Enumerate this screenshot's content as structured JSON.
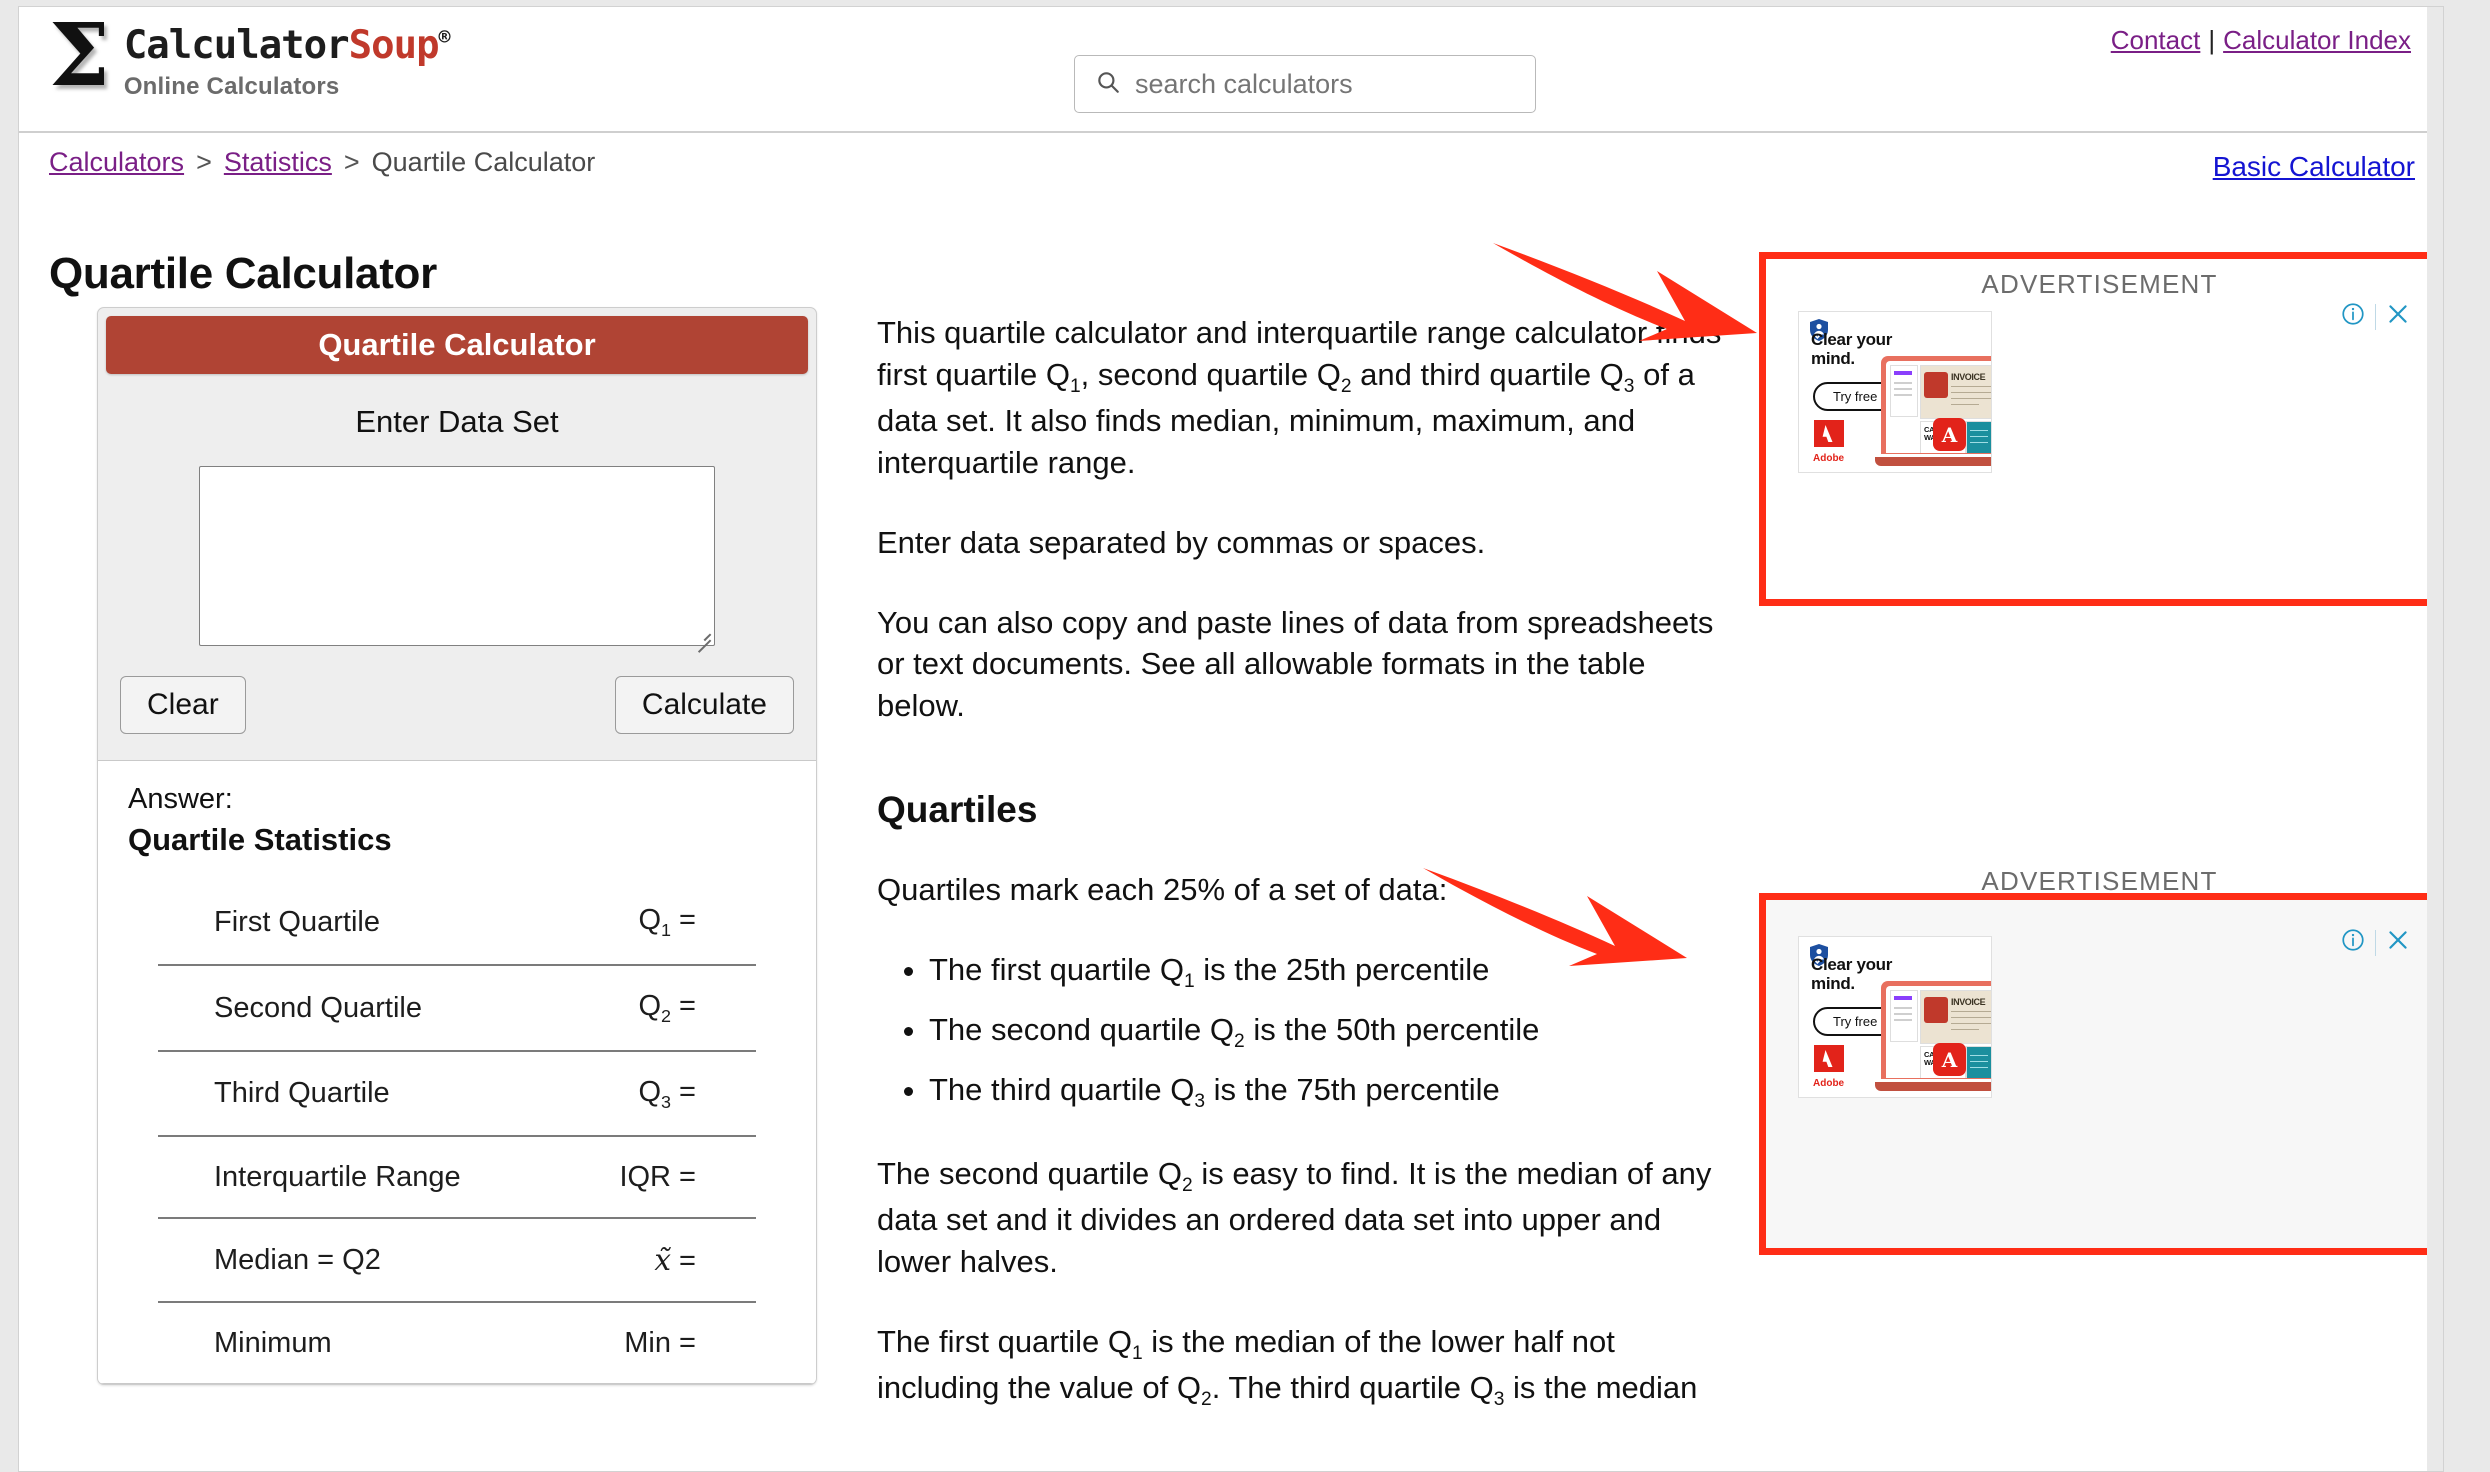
{
  "header": {
    "logo_sigma": "Σ",
    "logo_main": "Calculator",
    "logo_accent": "Soup",
    "logo_reg": "®",
    "logo_tagline": "Online Calculators",
    "search_placeholder": "search calculators",
    "link_contact": "Contact",
    "link_separator": "|",
    "link_index": "Calculator Index"
  },
  "breadcrumb": {
    "item1": "Calculators",
    "sep1": ">",
    "item2": "Statistics",
    "sep2": ">",
    "current": "Quartile Calculator",
    "basic_calculator": "Basic Calculator"
  },
  "page_title": "Quartile Calculator",
  "calculator": {
    "title": "Quartile Calculator",
    "subtitle": "Enter Data Set",
    "textarea_value": "",
    "clear_label": "Clear",
    "calculate_label": "Calculate",
    "answer_label": "Answer:",
    "answer_title": "Quartile Statistics",
    "rows": [
      {
        "label": "First Quartile",
        "symbol": "Q",
        "sub": "1",
        "eq": "="
      },
      {
        "label": "Second Quartile",
        "symbol": "Q",
        "sub": "2",
        "eq": "="
      },
      {
        "label": "Third Quartile",
        "symbol": "Q",
        "sub": "3",
        "eq": "="
      },
      {
        "label": "Interquartile Range",
        "symbol": "IQR",
        "sub": "",
        "eq": "="
      },
      {
        "label": "Median = Q2",
        "symbol": "x̃",
        "sub": "",
        "eq": "="
      },
      {
        "label": "Minimum",
        "symbol": "Min",
        "sub": "",
        "eq": "="
      }
    ]
  },
  "article": {
    "p1_a": "This quartile calculator and interquartile range calculator finds first quartile Q",
    "p1_b": ", second quartile Q",
    "p1_c": " and third quartile Q",
    "p1_d": " of a data set. It also finds median, minimum, maximum, and interquartile range.",
    "p2": "Enter data separated by commas or spaces.",
    "p3": "You can also copy and paste lines of data from spreadsheets or text documents. See all allowable formats in the table below.",
    "h2": "Quartiles",
    "p4": "Quartiles mark each 25% of a set of data:",
    "bullets": [
      {
        "a": "The first quartile Q",
        "sub": "1",
        "b": " is the 25th percentile"
      },
      {
        "a": "The second quartile Q",
        "sub": "2",
        "b": " is the 50th percentile"
      },
      {
        "a": "The third quartile Q",
        "sub": "3",
        "b": " is the 75th percentile"
      }
    ],
    "p5_a": "The second quartile Q",
    "p5_b": " is easy to find. It is the median of any data set and it divides an ordered data set into upper and lower halves.",
    "p6_a": "The first quartile Q",
    "p6_b": " is the median of the lower half not including the value of Q",
    "p6_c": ". The third quartile Q",
    "p6_d": " is the median"
  },
  "ads": [
    {
      "label": "ADVERTISEMENT",
      "headline": "Clear your mind.",
      "cta": "Try free",
      "brand": "Adobe",
      "doc_invoice": "INVOICE",
      "doc_camp": "CAMP WAIVER",
      "info_icon": "info-icon",
      "close_icon": "close-icon"
    },
    {
      "label": "ADVERTISEMENT",
      "headline": "Clear your mind.",
      "cta": "Try free",
      "brand": "Adobe",
      "doc_invoice": "INVOICE",
      "doc_camp": "CAMP WAIVER",
      "info_icon": "info-icon",
      "close_icon": "close-icon"
    }
  ],
  "colors": {
    "calc_header": "#b04434",
    "link_purple": "#7a1f86",
    "link_blue": "#1414d2",
    "annotation_red": "#ff2d16",
    "ad_control_blue": "#2196c4"
  }
}
